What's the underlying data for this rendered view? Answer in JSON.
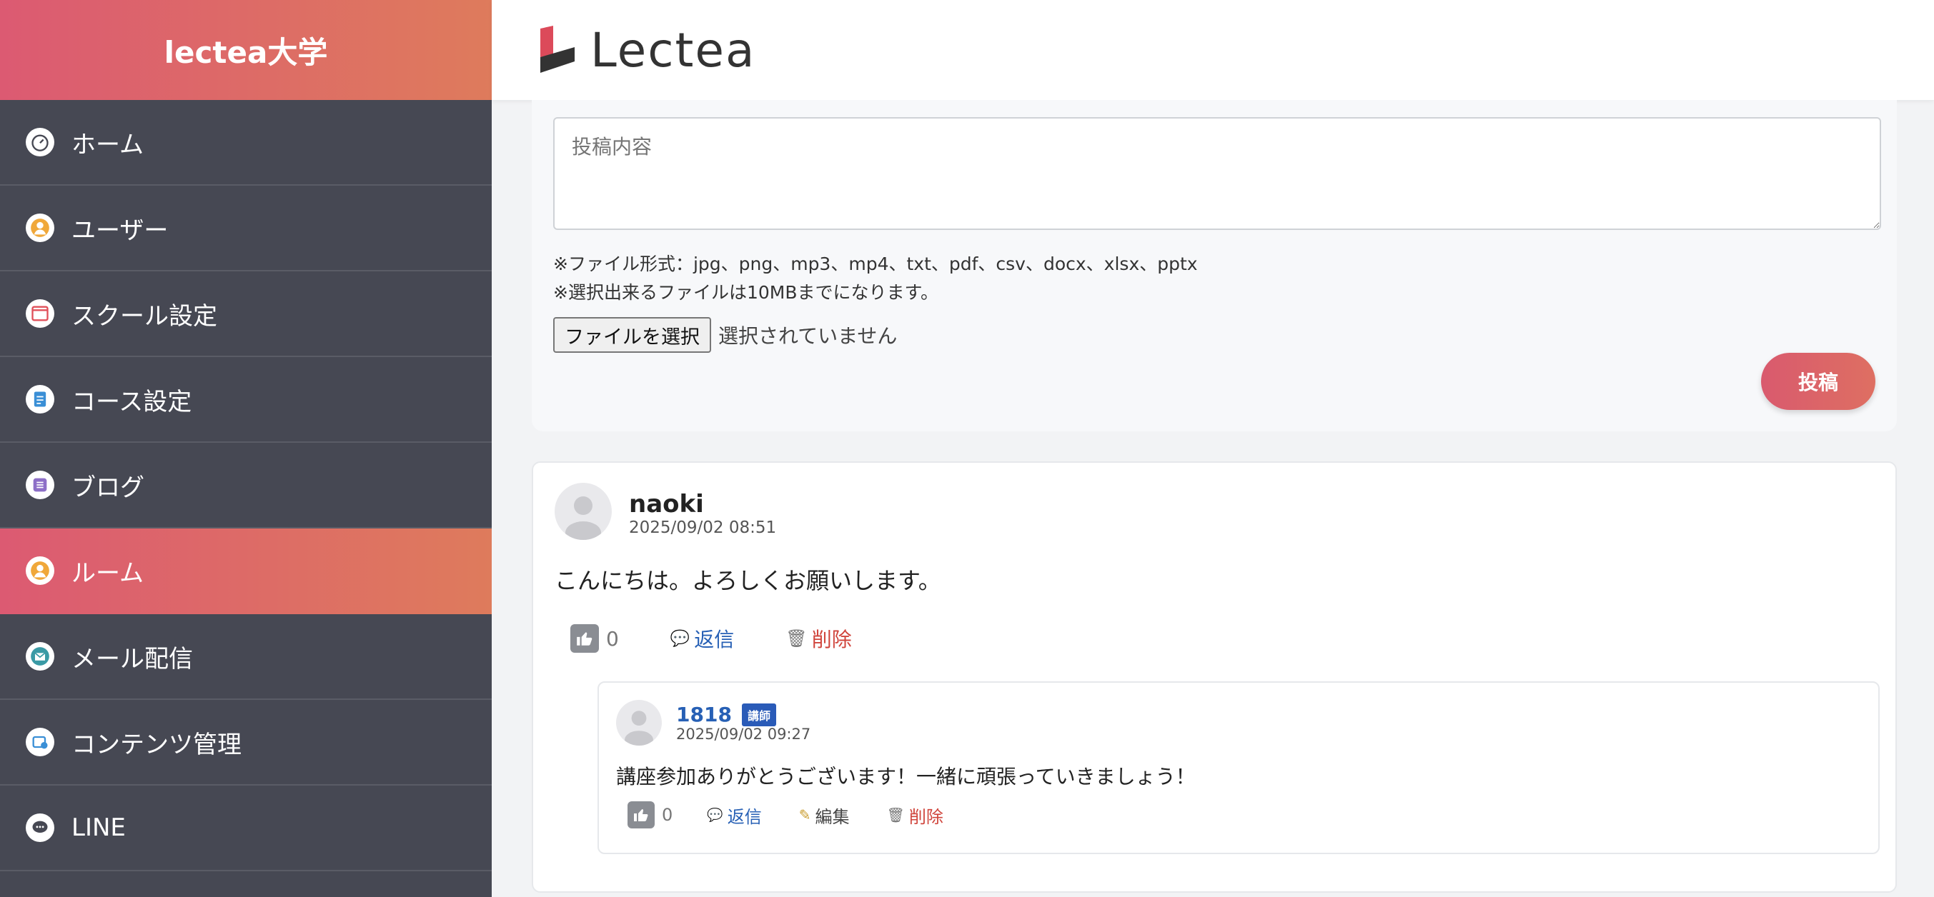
{
  "sidebar": {
    "brand": "lectea大学",
    "items": [
      {
        "label": "ホーム",
        "icon": "dashboard-icon"
      },
      {
        "label": "ユーザー",
        "icon": "user-icon"
      },
      {
        "label": "スクール設定",
        "icon": "window-icon"
      },
      {
        "label": "コース設定",
        "icon": "document-icon"
      },
      {
        "label": "ブログ",
        "icon": "blog-icon"
      },
      {
        "label": "ルーム",
        "icon": "room-icon",
        "active": true
      },
      {
        "label": "メール配信",
        "icon": "mail-icon"
      },
      {
        "label": "コンテンツ管理",
        "icon": "content-icon"
      },
      {
        "label": "LINE",
        "icon": "chat-icon"
      }
    ]
  },
  "header": {
    "logo_text": "Lectea"
  },
  "form": {
    "textarea_placeholder": "投稿内容",
    "note_formats": "※ファイル形式：jpg、png、mp3、mp4、txt、pdf、csv、docx、xlsx、pptx",
    "note_size": "※選択出来るファイルは10MBまでになります。",
    "file_button": "ファイルを選択",
    "file_status": "選択されていません",
    "submit": "投稿"
  },
  "post": {
    "author": "naoki",
    "date": "2025/09/02 08:51",
    "body": "こんにちは。よろしくお願いします。",
    "likes": "0",
    "reply_label": "返信",
    "delete_label": "削除",
    "reply": {
      "author": "1818",
      "badge": "講師",
      "date": "2025/09/02 09:27",
      "body": "講座参加ありがとうございます！一緒に頑張っていきましょう！",
      "likes": "0",
      "reply_label": "返信",
      "edit_label": "編集",
      "delete_label": "削除"
    }
  },
  "colors": {
    "accent_start": "#dc5a72",
    "accent_end": "#de7b5c",
    "sidebar": "#464853",
    "link": "#2760b5",
    "danger": "#d0453c"
  }
}
